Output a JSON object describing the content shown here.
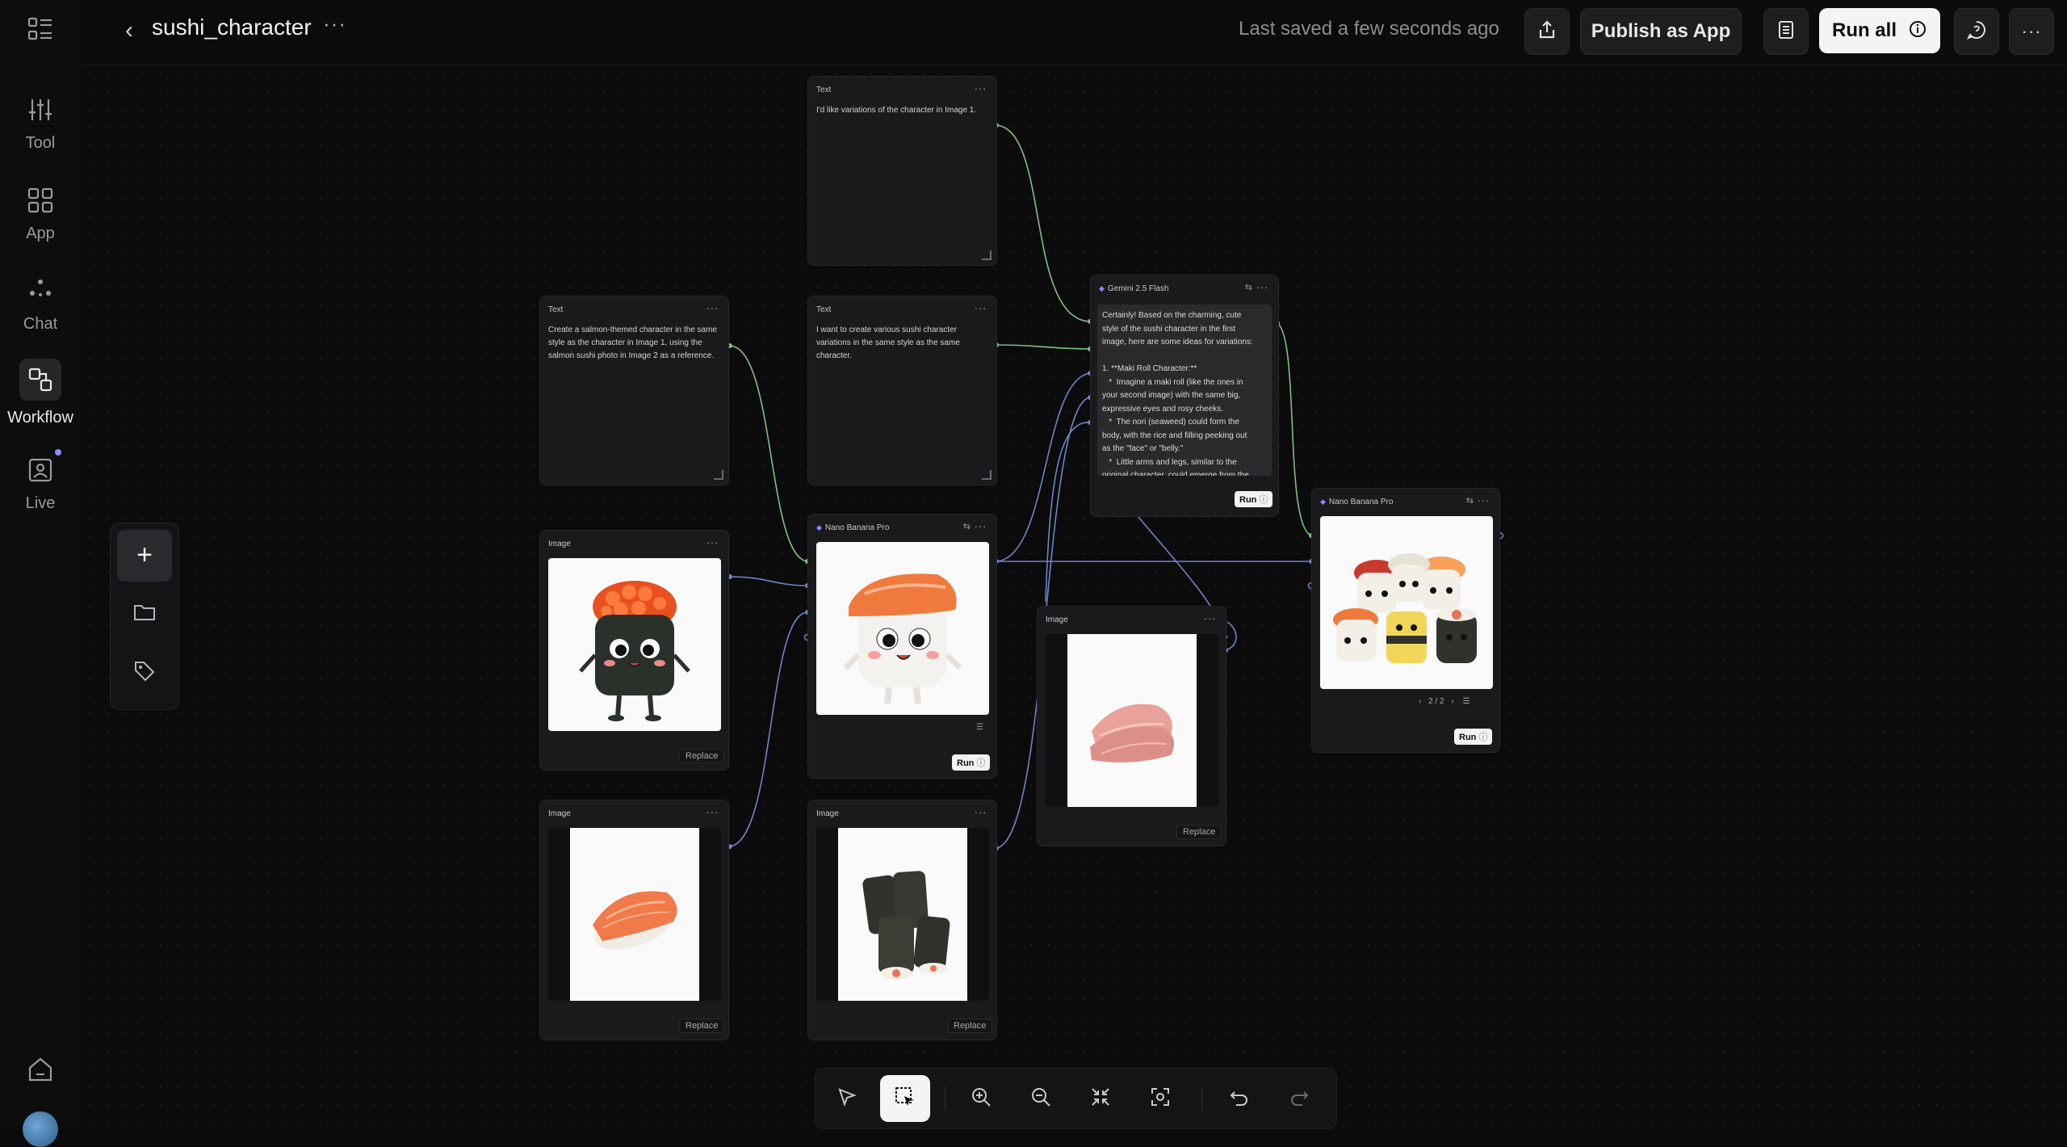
{
  "sidebar": {
    "items": [
      {
        "label": "Tool",
        "icon": "sliders-icon"
      },
      {
        "label": "App",
        "icon": "grid-icon"
      },
      {
        "label": "Chat",
        "icon": "chat-dots-icon"
      },
      {
        "label": "Workflow",
        "icon": "workflow-icon",
        "active": true
      },
      {
        "label": "Live",
        "icon": "live-icon"
      }
    ]
  },
  "header": {
    "title": "sushi_character",
    "more": "···",
    "saved_status": "Last saved a few seconds ago",
    "publish_label": "Publish as App",
    "run_all_label": "Run all"
  },
  "nodes": {
    "text1": {
      "type": "Text",
      "content": "I'd like variations of the character in Image 1."
    },
    "text2": {
      "type": "Text",
      "content": "Create a salmon-themed character in the same style as the character in Image 1, using the salmon sushi photo in Image 2 as a reference."
    },
    "text3": {
      "type": "Text",
      "content": "I want to create various sushi character variations in the same style as the same character."
    },
    "gemini": {
      "type": "Gemini 2.5 Flash",
      "content_lines": [
        "Certainly! Based on the charming, cute",
        "style of the sushi character in the first",
        "image, here are some ideas for variations:",
        "",
        "1. **Maki Roll Character:**",
        "   *  Imagine a maki roll (like the ones in",
        "your second image) with the same big,",
        "expressive eyes and rosy cheeks.",
        "   *  The nori (seaweed) could form the",
        "body, with the rice and filling peeking out",
        "as the \"face\" or \"belly.\"",
        "   *  Little arms and legs, similar to the",
        "original character, could emerge from the"
      ],
      "run_label": "Run"
    },
    "image1": {
      "type": "Image",
      "replace_label": "Replace"
    },
    "image2": {
      "type": "Image",
      "replace_label": "Replace"
    },
    "image3": {
      "type": "Image",
      "replace_label": "Replace"
    },
    "image4": {
      "type": "Image",
      "replace_label": "Replace"
    },
    "nano1": {
      "type": "Nano Banana Pro",
      "run_label": "Run"
    },
    "nano2": {
      "type": "Nano Banana Pro",
      "run_label": "Run",
      "pager": "2 / 2"
    }
  },
  "colors": {
    "wire_green": "#7fbf7f",
    "wire_blue": "#6d86c8",
    "accent": "#8b8cff"
  }
}
